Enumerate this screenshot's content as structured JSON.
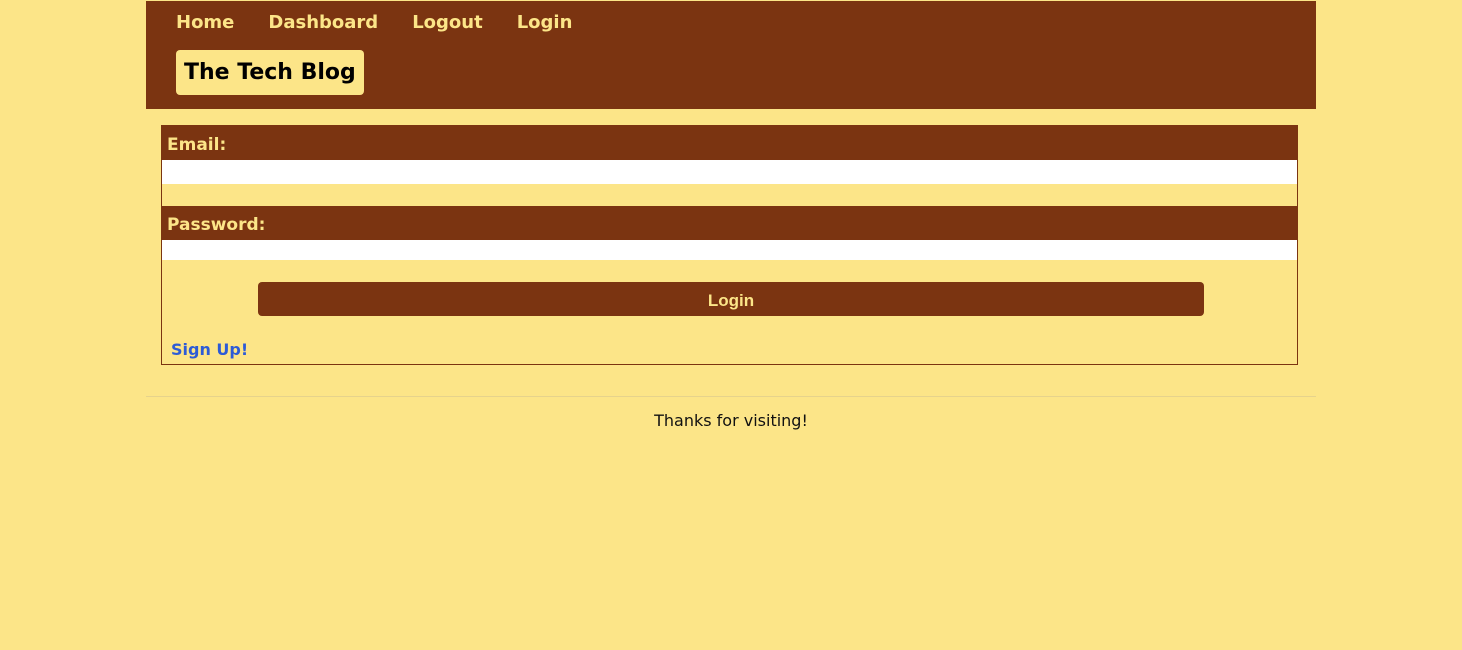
{
  "nav": {
    "items": [
      {
        "label": "Home"
      },
      {
        "label": "Dashboard"
      },
      {
        "label": "Logout"
      },
      {
        "label": "Login"
      }
    ],
    "brand": "The Tech Blog"
  },
  "form": {
    "email_label": "Email:",
    "email_value": "",
    "password_label": "Password:",
    "password_value": "",
    "submit_label": "Login",
    "signup_link": "Sign Up!"
  },
  "footer": {
    "text": "Thanks for visiting!"
  },
  "colors": {
    "background": "#fce588",
    "primary": "#7b3411",
    "link": "#2d5bd6"
  }
}
